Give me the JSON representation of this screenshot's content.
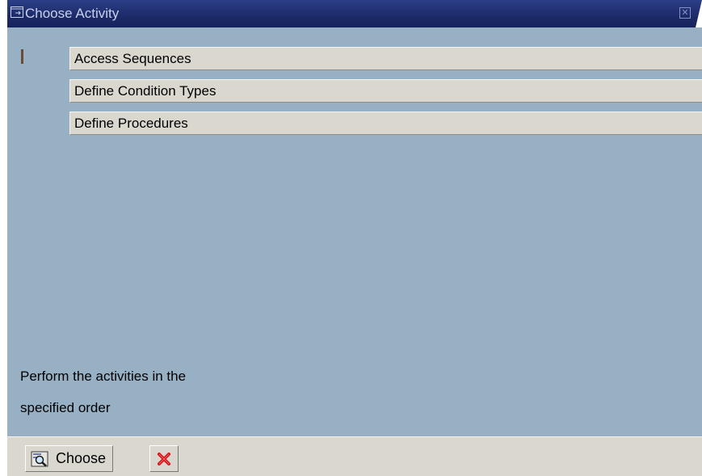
{
  "window": {
    "title": "Choose Activity",
    "close_glyph": "✕",
    "title_icon": "dialog-icon",
    "colors": {
      "titlebar": "#1f2f6f",
      "title_text": "#c8d0ec",
      "content_bg": "#98b0c4",
      "item_bg": "#dad7cf",
      "footer_bg": "#dad7cf"
    }
  },
  "activities": {
    "items": [
      {
        "label": "Access Sequences"
      },
      {
        "label": "Define Condition Types"
      },
      {
        "label": "Define Procedures"
      }
    ]
  },
  "info": {
    "lines": [
      "Perform the activities in the",
      "specified order"
    ]
  },
  "footer": {
    "choose_label": "Choose",
    "choose_icon": "choose-magnifier-icon",
    "cancel_icon": "cancel-x-icon"
  }
}
